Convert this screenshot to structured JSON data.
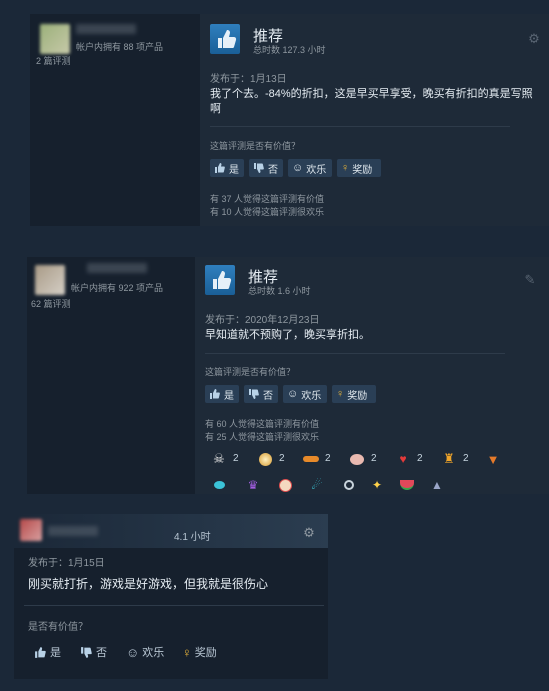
{
  "review1": {
    "owned": "帐户内拥有 88 项产品",
    "reviews": "2 篇评测",
    "rec_title": "推荐",
    "hours": "总时数 127.3 小时",
    "posted": "发布于：1月13日",
    "body": "我了个去。-84%的折扣，这是早买早享受，晚买有折扣的真是写照啊",
    "helpful_question": "这篇评测是否有价值？",
    "yes": "是",
    "no": "否",
    "funny": "欢乐",
    "award": "奖励",
    "helpful_count": "有 37 人觉得这篇评测有价值",
    "funny_count": "有 10 人觉得这篇评测很欢乐"
  },
  "review2": {
    "owned": "帐户内拥有 922 项产品",
    "reviews": "62 篇评测",
    "rec_title": "推荐",
    "hours": "总时数 1.6 小时",
    "posted": "发布于：2020年12月23日",
    "body": "早知道就不预购了，晚买享折扣。",
    "helpful_question": "这篇评测是否有价值？",
    "yes": "是",
    "no": "否",
    "funny": "欢乐",
    "award": "奖励",
    "helpful_count": "有 60 人觉得这篇评测有价值",
    "funny_count": "有 25 人觉得这篇评测很欢乐",
    "awards_row1": [
      {
        "icon": "winged-skull-award",
        "count": "2"
      },
      {
        "icon": "golden-orb-award",
        "count": "2"
      },
      {
        "icon": "hot-dog-award",
        "count": "2"
      },
      {
        "icon": "brain-award",
        "count": "2"
      },
      {
        "icon": "heart-fire-award",
        "count": "2"
      },
      {
        "icon": "golden-trophy-award",
        "count": "2"
      },
      {
        "icon": "fox-award",
        "count": ""
      }
    ],
    "awards_row2": [
      {
        "icon": "blue-orb-award"
      },
      {
        "icon": "purple-crown-award"
      },
      {
        "icon": "clown-face-award"
      },
      {
        "icon": "comet-award"
      },
      {
        "icon": "ring-award"
      },
      {
        "icon": "sparkle-award"
      },
      {
        "icon": "watermelon-award"
      },
      {
        "icon": "wolf-award"
      }
    ]
  },
  "review3": {
    "hours": "4.1 小时",
    "posted": "发布于：1月15日",
    "body": "刚买就打折，游戏是好游戏，但我就是很伤心",
    "helpful_question": "是否有价值？",
    "yes": "是",
    "no": "否",
    "funny": "欢乐",
    "award": "奖励"
  }
}
